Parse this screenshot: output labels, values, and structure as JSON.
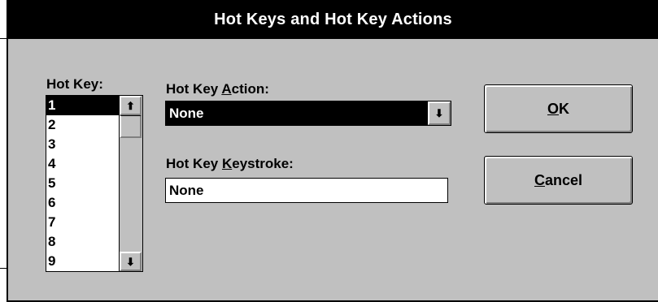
{
  "dialog": {
    "title": "Hot Keys and Hot Key Actions"
  },
  "hotkey_list": {
    "label": "Hot Key:",
    "items": [
      "1",
      "2",
      "3",
      "4",
      "5",
      "6",
      "7",
      "8",
      "9"
    ],
    "selected_index": 0,
    "scroll_up_glyph": "⬆",
    "scroll_down_glyph": "⬇"
  },
  "action": {
    "label_pre": "Hot Key ",
    "label_mnemonic": "A",
    "label_post": "ction:",
    "value": "None",
    "dropdown_glyph": "⬇"
  },
  "keystroke": {
    "label_pre": "Hot Key ",
    "label_mnemonic": "K",
    "label_post": "eystroke:",
    "value": "None"
  },
  "buttons": {
    "ok_mnemonic": "O",
    "ok_rest": "K",
    "cancel_mnemonic": "C",
    "cancel_rest": "ancel"
  },
  "colors": {
    "dialog_bg": "#c0c0c0",
    "titlebar_bg": "#000000",
    "selection_bg": "#000000"
  }
}
